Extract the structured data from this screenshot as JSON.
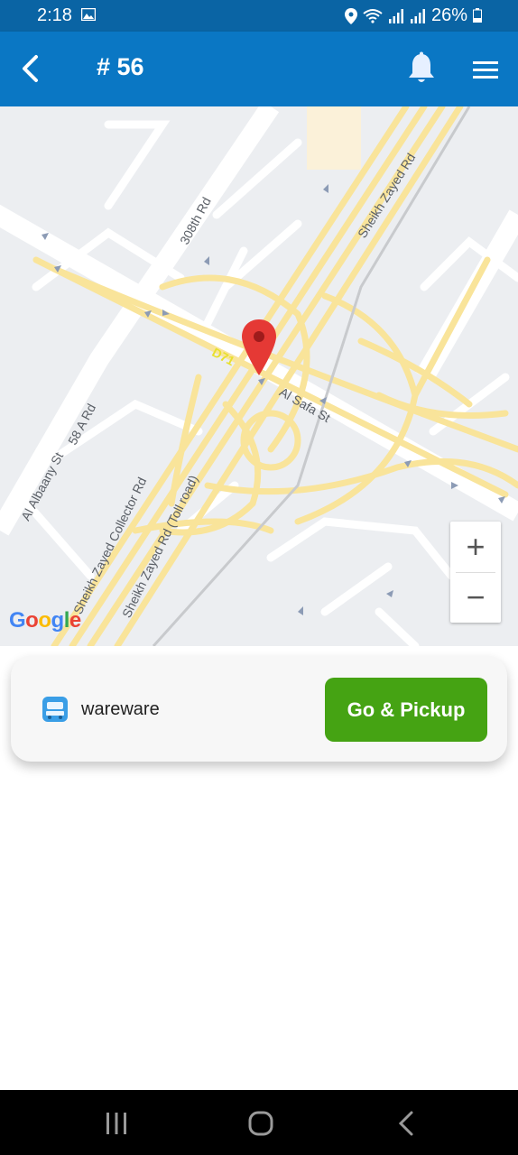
{
  "status_bar": {
    "time": "2:18",
    "battery": "26%"
  },
  "app_bar": {
    "title": "# 56"
  },
  "map": {
    "labels": {
      "road_308th": "308th Rd",
      "sheikh_zayed_top": "Sheikh Zayed Rd",
      "d71": "D71",
      "al_safa": "Al Safa St",
      "al_albaany": "Al Albaany St",
      "street_58a": "58 A Rd",
      "collector": "Sheikh Zayed Collector Rd",
      "toll": "Sheikh Zayed Rd (Toll road)"
    },
    "zoom_in": "+",
    "zoom_out": "−",
    "attribution": [
      "G",
      "o",
      "o",
      "g",
      "l",
      "e"
    ]
  },
  "pickup_card": {
    "name": "wareware",
    "button_label": "Go & Pickup"
  },
  "colors": {
    "status_bar": "#0a64a4",
    "app_bar": "#0a77c4",
    "go_button": "#45a313",
    "pin": "#e53935"
  }
}
